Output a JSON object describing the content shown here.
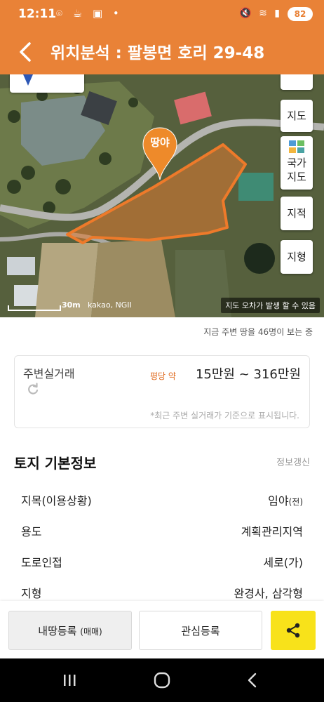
{
  "status_bar": {
    "time": "12:11",
    "left_icons": "⌾ ☕ ▣ •",
    "right_icons": "🔇 ≋ ▮",
    "battery": "82"
  },
  "header": {
    "title": "위치분석 : 팔봉면 호리 29-48"
  },
  "map": {
    "land_badge": "땅야",
    "controls": {
      "map": "지도",
      "national_map_line1": "국가",
      "national_map_line2": "지도",
      "cadastral": "지적",
      "terrain": "지형"
    },
    "scale": "30m",
    "attribution": "kakao, NGII",
    "notice": "지도 오차가 발생 할 수 있음"
  },
  "viewer_note": "지금 주변 땅을 46명이 보는 중",
  "nearby_transactions": {
    "title": "주변실거래",
    "price_prefix": "평당 약",
    "price_range": "15만원 ~ 316만원",
    "footnote": "*최근 주변 실거래가 기준으로 표시됩니다."
  },
  "basic_info": {
    "title": "토지 기본정보",
    "refresh": "정보갱신",
    "rows": [
      {
        "label": "지목(이용상황)",
        "value": "임야",
        "suffix": "(전)"
      },
      {
        "label": "용도",
        "value": "계획관리지역"
      },
      {
        "label": "도로인접",
        "value": "세로(가)"
      },
      {
        "label": "지형",
        "value": "완경사, 삼각형"
      }
    ]
  },
  "actions": {
    "register": "내땅등록",
    "register_suffix": "(매매)",
    "favorite": "관심등록"
  },
  "colors": {
    "brand_orange": "#e98237",
    "price_accent": "#e06a1e",
    "share_yellow": "#f8e21a"
  }
}
